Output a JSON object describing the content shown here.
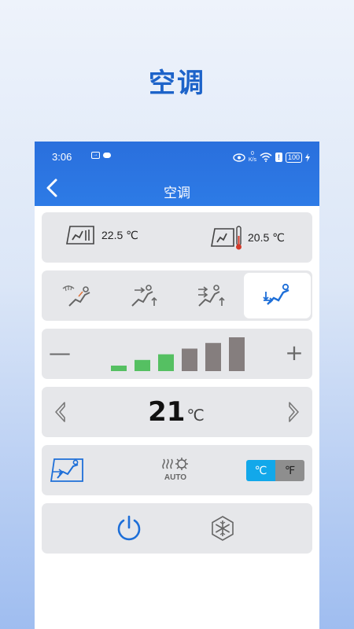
{
  "promo": {
    "title": "空调"
  },
  "status_bar": {
    "time": "3:06",
    "battery": "100",
    "net_speed_top": "0",
    "net_speed_unit": "K/s",
    "wifi_sub": "6"
  },
  "header": {
    "title": "空调"
  },
  "temperatures": {
    "left_value": "22.5 ℃",
    "right_value": "20.5 ℃"
  },
  "seat_modes": {
    "items": [
      {
        "icon": "seat-defrost-icon",
        "active": false
      },
      {
        "icon": "seat-airflow-up-icon",
        "active": false
      },
      {
        "icon": "seat-airflow-both-icon",
        "active": false
      },
      {
        "icon": "seat-airflow-feet-icon",
        "active": true
      }
    ]
  },
  "fan": {
    "minus_label": "—",
    "plus_label": "+",
    "levels_total": 6,
    "levels_on": 3,
    "on_color": "#55c062",
    "off_color": "#857e7e"
  },
  "temperature_control": {
    "value": "21",
    "unit": "℃"
  },
  "options": {
    "auto_label": "AUTO",
    "unit_celsius": "℃",
    "unit_fahrenheit": "℉",
    "selected_unit": "celsius"
  },
  "colors": {
    "accent": "#2a6fdd",
    "icon_blue": "#1e6fd8",
    "card_bg": "#e6e7ea"
  }
}
